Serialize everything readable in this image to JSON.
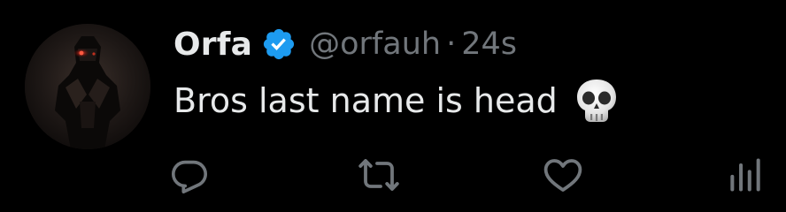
{
  "tweet": {
    "display_name": "Orfa",
    "verified": true,
    "handle": "@orfauh",
    "separator": "·",
    "timestamp": "24s",
    "text": "Bros last name is head",
    "emoji": "skull-emoji"
  },
  "actions": {
    "reply": "reply-icon",
    "retweet": "retweet-icon",
    "like": "heart-icon",
    "views": "views-icon"
  },
  "colors": {
    "background": "#000000",
    "primary_text": "#e7e9ea",
    "secondary_text": "#71767b",
    "verified_badge": "#1d9bf0"
  }
}
